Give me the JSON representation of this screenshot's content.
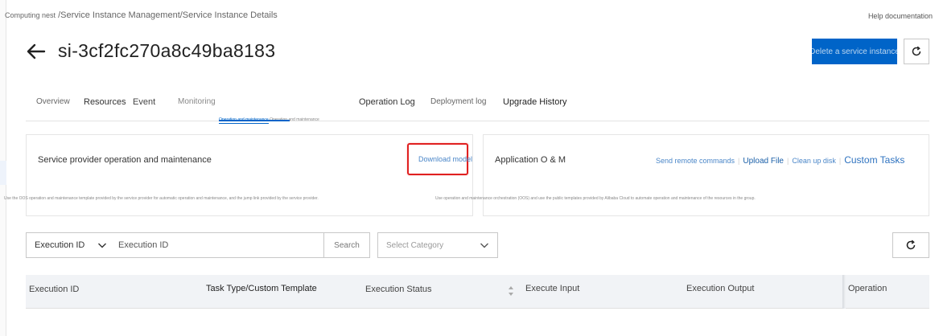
{
  "breadcrumb": {
    "first": "Computing nest",
    "rest": "/Service Instance Management/Service Instance Details"
  },
  "help_link": "Help documentation",
  "page_title": "si-3cf2fc270a8c49ba8183",
  "delete_button": "Delete a service instance",
  "tabs": {
    "overview": "Overview",
    "resources": "Resources",
    "event": "Event",
    "monitoring": "Monitoring",
    "operation_log": "Operation Log",
    "deployment_log": "Deployment log",
    "upgrade_history": "Upgrade History"
  },
  "subtabs": {
    "active": "Operation and maintenance",
    "other": "Operation and maintenance"
  },
  "provider_card": {
    "title": "Service provider operation and maintenance",
    "download_link": "Download model",
    "description": "Use the OOS operation and maintenance template provided by the service provider for automatic operation and maintenance, and the jump link provided by the service provider."
  },
  "app_card": {
    "title": "Application O & M",
    "actions": {
      "send_remote_commands": "Send remote commands",
      "upload_file": "Upload File",
      "clean_up_disk": "Clean up disk",
      "custom_tasks": "Custom Tasks"
    },
    "description": "Use operation and maintenance orchestration (OOS) and use the public templates provided by Alibaba Cloud to automate operation and maintenance of the resources in the group."
  },
  "filters": {
    "field_select": "Execution ID",
    "search_placeholder": "Execution ID",
    "search_button": "Search",
    "category_placeholder": "Select Category"
  },
  "table": {
    "columns": {
      "execution_id": "Execution ID",
      "task_type": "Task Type/Custom Template",
      "execution_status": "Execution Status",
      "execute_input": "Execute Input",
      "execution_output": "Execution Output",
      "operation": "Operation"
    }
  },
  "icons": {
    "back": "arrow-left-icon",
    "refresh": "refresh-icon",
    "chevron": "chevron-down-icon",
    "sort": "sort-icon"
  },
  "colors": {
    "primary": "#0064c8",
    "link": "#4a86c8",
    "highlight": "#e02020"
  }
}
